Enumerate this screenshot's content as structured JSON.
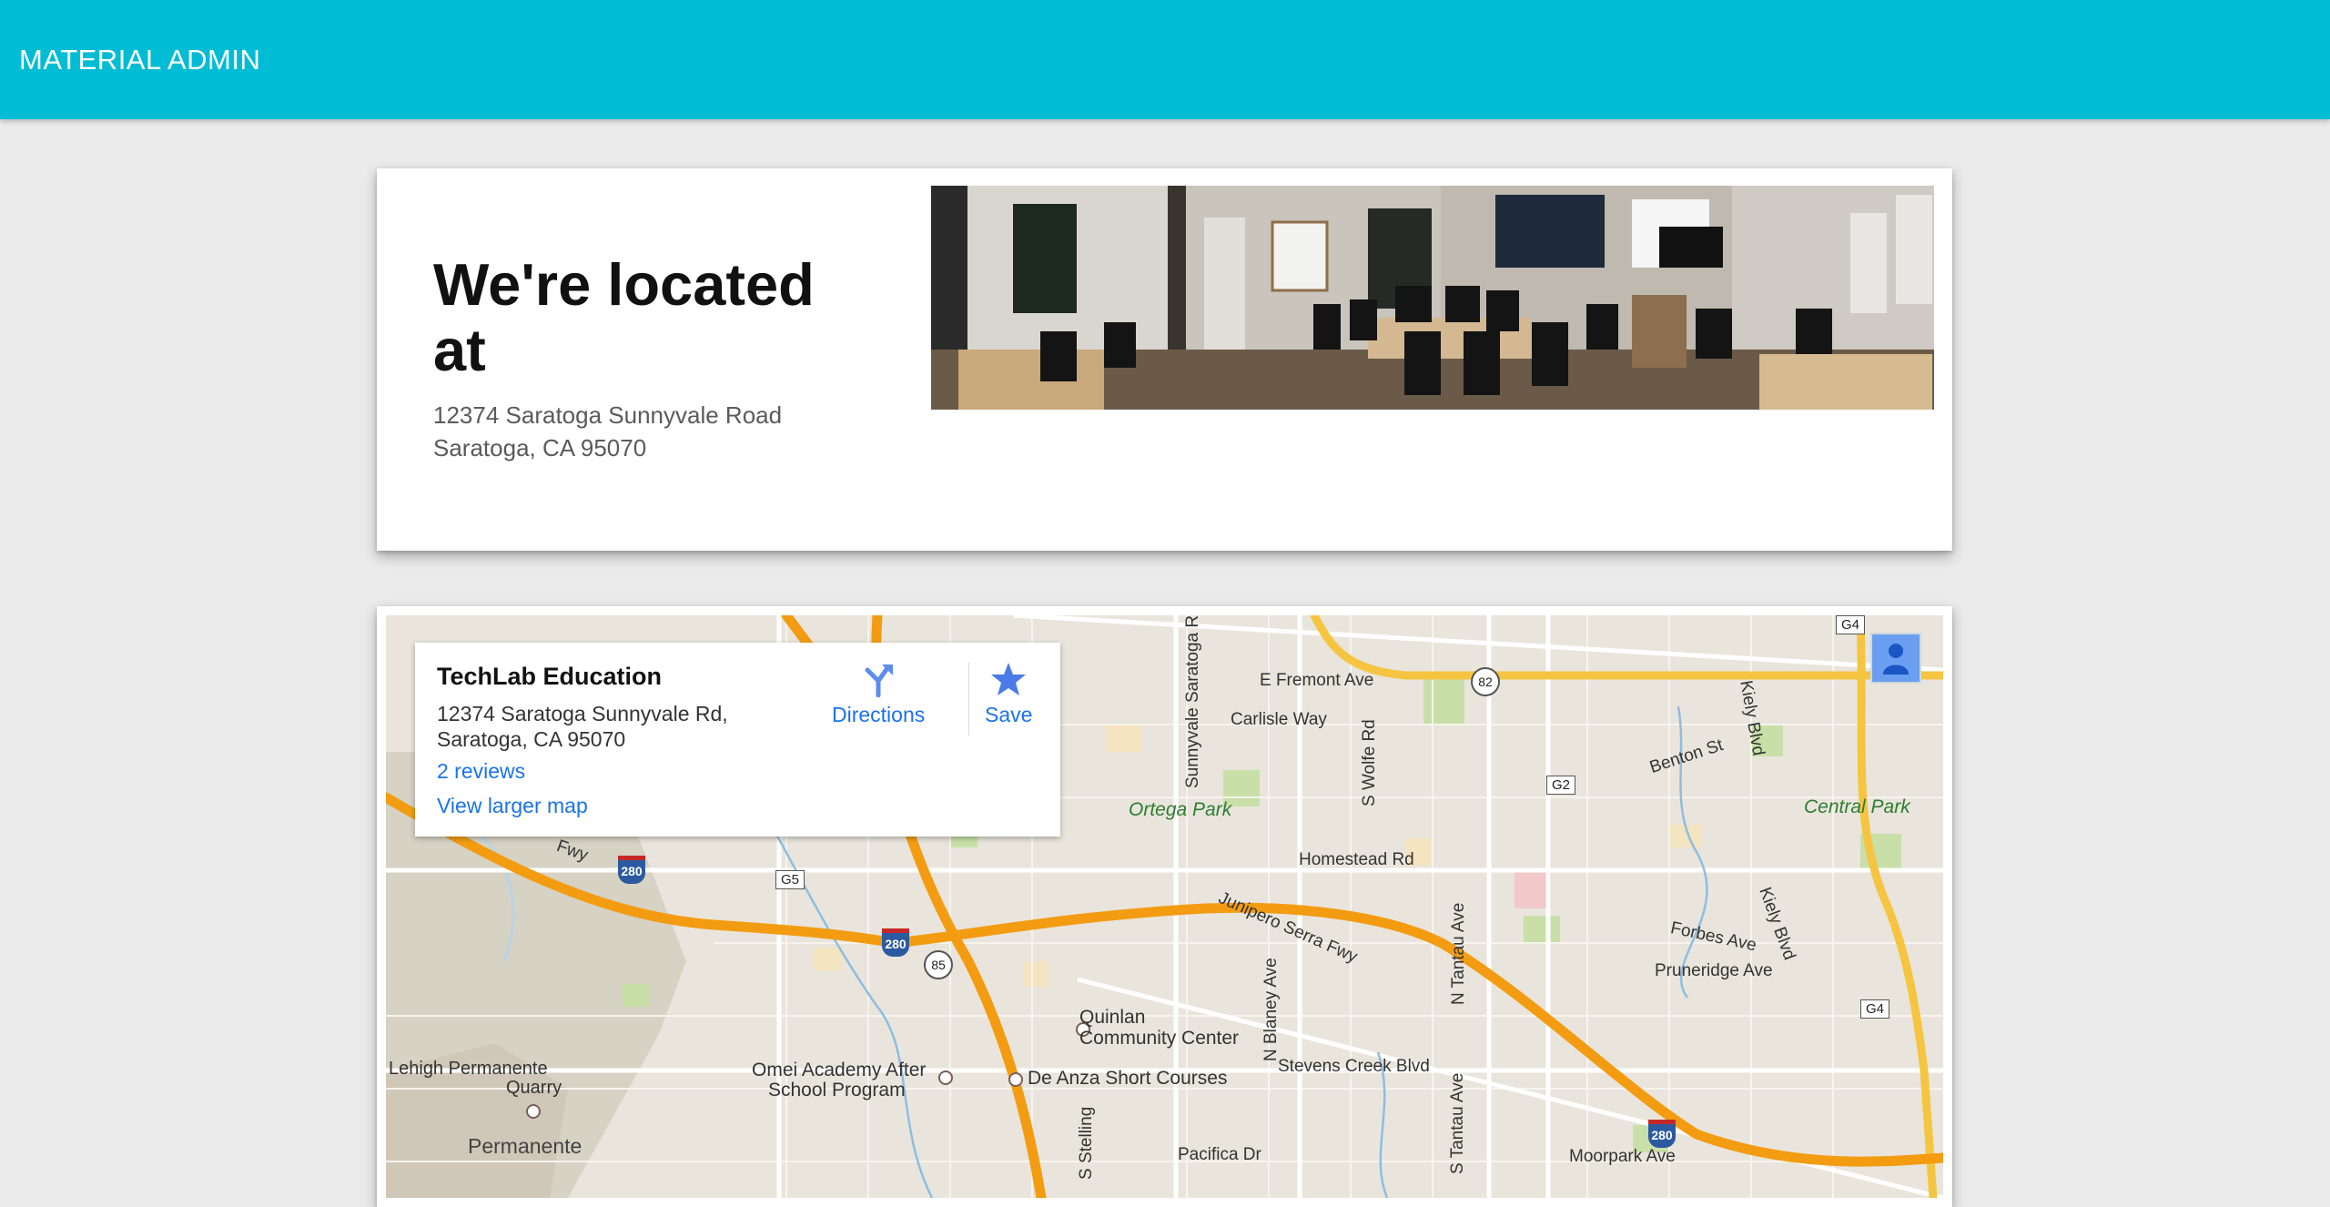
{
  "app": {
    "title": "MATERIAL ADMIN"
  },
  "location": {
    "heading": "We're located at",
    "address_line1": "12374 Saratoga Sunnyvale Road",
    "address_line2": "Saratoga, CA 95070"
  },
  "map": {
    "info": {
      "name": "TechLab Education",
      "address_line1": "12374 Saratoga Sunnyvale Rd,",
      "address_line2": "Saratoga, CA 95070",
      "reviews": "2 reviews",
      "larger_map": "View larger map",
      "directions": "Directions",
      "save": "Save"
    },
    "labels": {
      "fremont": "E Fremont Ave",
      "carlisle": "Carlisle Way",
      "ortega": "Ortega Park",
      "central": "Central Park",
      "homestead": "Homestead Rd",
      "junipero": "Junipero Serra Fwy",
      "benton": "Benton St",
      "forbes": "Forbes Ave",
      "pruneridge": "Pruneridge Ave",
      "quinlan1": "Quinlan",
      "quinlan2": "Community Center",
      "omei1": "Omei Academy After",
      "omei2": "School Program",
      "deanza": "De Anza Short Courses",
      "lehigh1": "Lehigh Permanente",
      "lehigh2": "Quarry",
      "permanente": "Permanente",
      "stevens": "Stevens Creek Blvd",
      "pacifica": "Pacifica Dr",
      "moorpark": "Moorpark Ave",
      "blaney": "N Blaney Ave",
      "tantau": "N Tantau Ave",
      "wolfe": "S Wolfe Rd",
      "saratoga_rd": "Sunnyvale Saratoga Rd",
      "kiely": "Kiely Blvd",
      "kiely2": "Kiely Blvd",
      "fwy": "Fwy",
      "stelling": "S Stelling",
      "stantau": "S Tantau Ave"
    },
    "shields": {
      "i280_a": "280",
      "i280_b": "280",
      "i280_c": "280",
      "r85": "85",
      "r82": "82",
      "g2": "G2",
      "g4_top": "G4",
      "g4_bottom": "G4",
      "g5": "G5"
    }
  }
}
